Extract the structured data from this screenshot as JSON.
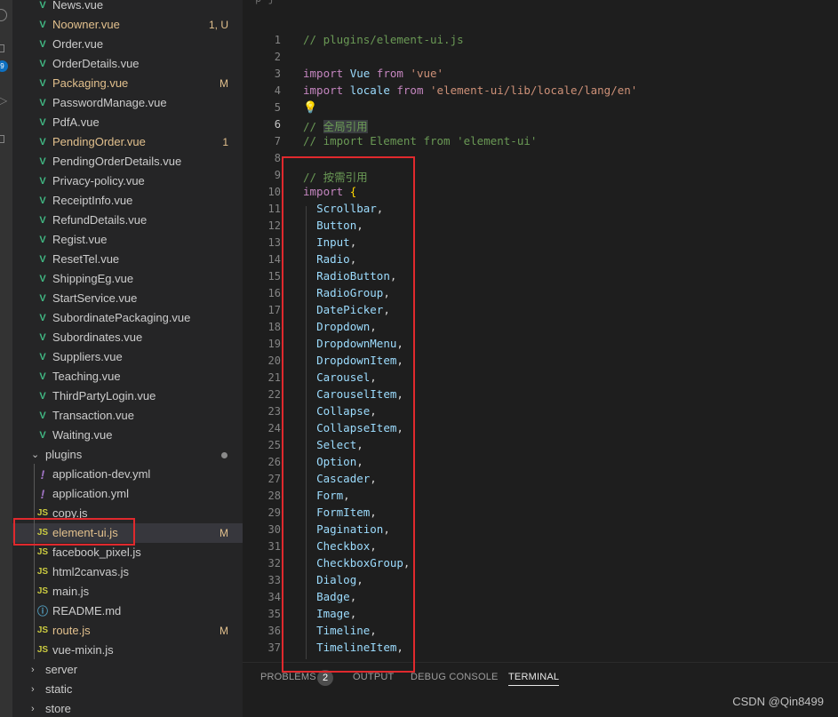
{
  "sidebar": {
    "files": [
      {
        "name": "News.vue",
        "icon": "vue",
        "color": "plain",
        "badge": ""
      },
      {
        "name": "Noowner.vue",
        "icon": "vue",
        "color": "untracked",
        "badge": "1, U"
      },
      {
        "name": "Order.vue",
        "icon": "vue",
        "color": "plain",
        "badge": ""
      },
      {
        "name": "OrderDetails.vue",
        "icon": "vue",
        "color": "plain",
        "badge": ""
      },
      {
        "name": "Packaging.vue",
        "icon": "vue",
        "color": "mod",
        "badge": "M"
      },
      {
        "name": "PasswordManage.vue",
        "icon": "vue",
        "color": "plain",
        "badge": ""
      },
      {
        "name": "PdfA.vue",
        "icon": "vue",
        "color": "plain",
        "badge": ""
      },
      {
        "name": "PendingOrder.vue",
        "icon": "vue",
        "color": "mod",
        "badge": "1"
      },
      {
        "name": "PendingOrderDetails.vue",
        "icon": "vue",
        "color": "plain",
        "badge": ""
      },
      {
        "name": "Privacy-policy.vue",
        "icon": "vue",
        "color": "plain",
        "badge": ""
      },
      {
        "name": "ReceiptInfo.vue",
        "icon": "vue",
        "color": "plain",
        "badge": ""
      },
      {
        "name": "RefundDetails.vue",
        "icon": "vue",
        "color": "plain",
        "badge": ""
      },
      {
        "name": "Regist.vue",
        "icon": "vue",
        "color": "plain",
        "badge": ""
      },
      {
        "name": "ResetTel.vue",
        "icon": "vue",
        "color": "plain",
        "badge": ""
      },
      {
        "name": "ShippingEg.vue",
        "icon": "vue",
        "color": "plain",
        "badge": ""
      },
      {
        "name": "StartService.vue",
        "icon": "vue",
        "color": "plain",
        "badge": ""
      },
      {
        "name": "SubordinatePackaging.vue",
        "icon": "vue",
        "color": "plain",
        "badge": ""
      },
      {
        "name": "Subordinates.vue",
        "icon": "vue",
        "color": "plain",
        "badge": ""
      },
      {
        "name": "Suppliers.vue",
        "icon": "vue",
        "color": "plain",
        "badge": ""
      },
      {
        "name": "Teaching.vue",
        "icon": "vue",
        "color": "plain",
        "badge": ""
      },
      {
        "name": "ThirdPartyLogin.vue",
        "icon": "vue",
        "color": "plain",
        "badge": ""
      },
      {
        "name": "Transaction.vue",
        "icon": "vue",
        "color": "plain",
        "badge": ""
      },
      {
        "name": "Waiting.vue",
        "icon": "vue",
        "color": "plain",
        "badge": ""
      }
    ],
    "plugins_folder": {
      "name": "plugins",
      "chevron": "⌄",
      "has_changes_dot": true
    },
    "plugin_files": [
      {
        "name": "application-dev.yml",
        "icon": "yml",
        "color": "plain",
        "badge": ""
      },
      {
        "name": "application.yml",
        "icon": "yml",
        "color": "plain",
        "badge": ""
      },
      {
        "name": "copy.js",
        "icon": "js",
        "color": "plain",
        "badge": ""
      },
      {
        "name": "element-ui.js",
        "icon": "js",
        "color": "mod",
        "badge": "M",
        "selected": true
      },
      {
        "name": "facebook_pixel.js",
        "icon": "js",
        "color": "plain",
        "badge": ""
      },
      {
        "name": "html2canvas.js",
        "icon": "js",
        "color": "plain",
        "badge": ""
      },
      {
        "name": "main.js",
        "icon": "js",
        "color": "plain",
        "badge": ""
      },
      {
        "name": "README.md",
        "icon": "md",
        "color": "plain",
        "badge": ""
      },
      {
        "name": "route.js",
        "icon": "js",
        "color": "mod",
        "badge": "M"
      },
      {
        "name": "vue-mixin.js",
        "icon": "js",
        "color": "plain",
        "badge": ""
      }
    ],
    "closed_folders": [
      {
        "name": "server",
        "chevron": "›"
      },
      {
        "name": "static",
        "chevron": "›"
      },
      {
        "name": "store",
        "chevron": "›"
      }
    ],
    "icon_glyphs": {
      "vue": "V",
      "js": "JS",
      "yml": "!",
      "md": "ⓘ"
    },
    "activity_badge": "9"
  },
  "editor": {
    "top_fragment": "p                    j",
    "active_line": 6,
    "lines": [
      {
        "n": "1",
        "html": "<span class='t-comment'>// plugins/element-ui.js</span>"
      },
      {
        "n": "2",
        "html": ""
      },
      {
        "n": "3",
        "html": "<span class='t-kw'>import</span> <span class='t-id'>Vue</span> <span class='t-kw'>from</span> <span class='t-str'>'vue'</span>"
      },
      {
        "n": "4",
        "html": "<span class='t-kw'>import</span> <span class='t-id'>locale</span> <span class='t-kw'>from</span> <span class='t-str'>'element-ui/lib/locale/lang/en'</span>"
      },
      {
        "n": "5",
        "html": "<span class='bulb'>💡</span>"
      },
      {
        "n": "6",
        "html": "<span class='t-comment'>// <span class='t-hl'>全局引用</span></span>"
      },
      {
        "n": "7",
        "html": "<span class='t-comment'>// import Element from 'element-ui'</span>"
      },
      {
        "n": "8",
        "html": ""
      },
      {
        "n": "9",
        "html": "<span class='t-comment'>// 按需引用</span>"
      },
      {
        "n": "10",
        "html": "<span class='t-kw'>import</span> <span class='t-brace'>{</span>"
      },
      {
        "n": "11",
        "html": "  <span class='t-id'>Scrollbar</span>,"
      },
      {
        "n": "12",
        "html": "  <span class='t-id'>Button</span>,"
      },
      {
        "n": "13",
        "html": "  <span class='t-id'>Input</span>,"
      },
      {
        "n": "14",
        "html": "  <span class='t-id'>Radio</span>,"
      },
      {
        "n": "15",
        "html": "  <span class='t-id'>RadioButton</span>,"
      },
      {
        "n": "16",
        "html": "  <span class='t-id'>RadioGroup</span>,"
      },
      {
        "n": "17",
        "html": "  <span class='t-id'>DatePicker</span>,"
      },
      {
        "n": "18",
        "html": "  <span class='t-id'>Dropdown</span>,"
      },
      {
        "n": "19",
        "html": "  <span class='t-id'>DropdownMenu</span>,"
      },
      {
        "n": "20",
        "html": "  <span class='t-id'>DropdownItem</span>,"
      },
      {
        "n": "21",
        "html": "  <span class='t-id'>Carousel</span>,"
      },
      {
        "n": "22",
        "html": "  <span class='t-id'>CarouselItem</span>,"
      },
      {
        "n": "23",
        "html": "  <span class='t-id'>Collapse</span>,"
      },
      {
        "n": "24",
        "html": "  <span class='t-id'>CollapseItem</span>,"
      },
      {
        "n": "25",
        "html": "  <span class='t-id'>Select</span>,"
      },
      {
        "n": "26",
        "html": "  <span class='t-id'>Option</span>,"
      },
      {
        "n": "27",
        "html": "  <span class='t-id'>Cascader</span>,"
      },
      {
        "n": "28",
        "html": "  <span class='t-id'>Form</span>,"
      },
      {
        "n": "29",
        "html": "  <span class='t-id'>FormItem</span>,"
      },
      {
        "n": "30",
        "html": "  <span class='t-id'>Pagination</span>,"
      },
      {
        "n": "31",
        "html": "  <span class='t-id'>Checkbox</span>,"
      },
      {
        "n": "32",
        "html": "  <span class='t-id'>CheckboxGroup</span>,"
      },
      {
        "n": "33",
        "html": "  <span class='t-id'>Dialog</span>,"
      },
      {
        "n": "34",
        "html": "  <span class='t-id'>Badge</span>,"
      },
      {
        "n": "35",
        "html": "  <span class='t-id'>Image</span>,"
      },
      {
        "n": "36",
        "html": "  <span class='t-id'>Timeline</span>,"
      },
      {
        "n": "37",
        "html": "  <span class='t-id'>TimelineItem</span>,"
      }
    ]
  },
  "panel": {
    "tabs": [
      {
        "label": "PROBLEMS",
        "active": false
      },
      {
        "label": "OUTPUT",
        "active": false
      },
      {
        "label": "DEBUG CONSOLE",
        "active": false
      },
      {
        "label": "TERMINAL",
        "active": true
      }
    ],
    "problems_count": "2"
  },
  "watermark": "CSDN @Qin8499",
  "colors": {
    "annotation_red": "#e0292d",
    "modified": "#e2c08d",
    "vue_green": "#41b883"
  }
}
